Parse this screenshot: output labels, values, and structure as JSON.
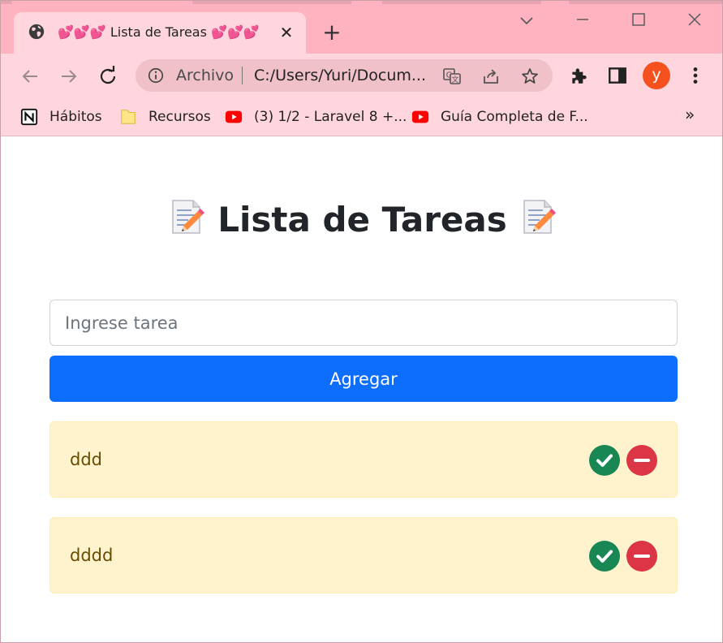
{
  "browser": {
    "tab": {
      "title": "💕💕💕 Lista de Tareas 💕💕💕",
      "close_label": "✕"
    },
    "new_tab_label": "+",
    "address": {
      "scheme_label": "Archivo",
      "url": "C:/Users/Yuri/Docum..."
    },
    "profile_initial": "y",
    "profile_color": "#f4511e",
    "theme_color": "#ffb2c0",
    "bookmarks": [
      {
        "label": "Hábitos",
        "icon": "notion-icon"
      },
      {
        "label": "Recursos",
        "icon": "folder-icon"
      },
      {
        "label": "(3) 1/2 - Laravel 8 +...",
        "icon": "youtube-icon"
      },
      {
        "label": "Guía Completa de F...",
        "icon": "youtube-icon"
      }
    ],
    "bookmarks_overflow_label": "»"
  },
  "app": {
    "title": "Lista de Tareas",
    "title_icon": "memo-icon",
    "input": {
      "placeholder": "Ingrese tarea",
      "value": ""
    },
    "add_button_label": "Agregar",
    "tasks": [
      {
        "text": "ddd"
      },
      {
        "text": "dddd"
      }
    ],
    "colors": {
      "primary": "#0d6efd",
      "success": "#198754",
      "danger": "#dc3545",
      "task_background": "#fff3cd"
    }
  }
}
